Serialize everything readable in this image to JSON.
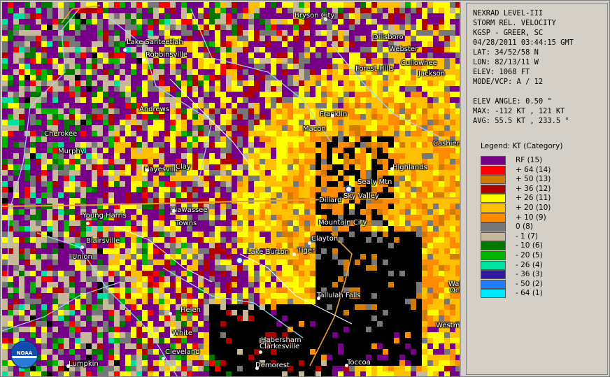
{
  "panel": {
    "product": "NEXRAD LEVEL-III",
    "type": "STORM REL. VELOCITY",
    "site": "KGSP - GREER, SC",
    "datetime": "04/28/2011 03:44:15 GMT",
    "lat": "LAT: 34/52/58 N",
    "lon": "LON: 82/13/11 W",
    "elev": "ELEV: 1068 FT",
    "mode": "MODE/VCP: A / 12",
    "elev_angle": "ELEV ANGLE: 0.50 °",
    "max": "MAX: -112 KT , 121 KT",
    "avg": "AVG: 55.5 KT , 233.5 °"
  },
  "legend": {
    "title": "Legend: KT (Category)",
    "items": [
      {
        "label": "RF  (15)",
        "color": "#770088"
      },
      {
        "label": "+ 64  (14)",
        "color": "#ff0000"
      },
      {
        "label": "+ 50  (13)",
        "color": "#d27b00"
      },
      {
        "label": "+ 36  (12)",
        "color": "#b00000"
      },
      {
        "label": "+ 26  (11)",
        "color": "#ffff00"
      },
      {
        "label": "+ 20  (10)",
        "color": "#ffc000"
      },
      {
        "label": "+ 10  (9)",
        "color": "#ff8c00"
      },
      {
        "label": "0  (8)",
        "color": "#777777"
      },
      {
        "label": "- 1  (7)",
        "color": "#c8b89a"
      },
      {
        "label": "- 10  (6)",
        "color": "#007800"
      },
      {
        "label": "- 20  (5)",
        "color": "#00b400"
      },
      {
        "label": "- 26  (4)",
        "color": "#00e0a0"
      },
      {
        "label": "- 36  (3)",
        "color": "#3018a0"
      },
      {
        "label": "- 50  (2)",
        "color": "#1e7cff"
      },
      {
        "label": "- 64  (1)",
        "color": "#00e8ff"
      }
    ]
  },
  "map": {
    "logo_text": "NOAA",
    "cities": [
      "Bryson City",
      "Dillsboro",
      "Lake Santeetlah",
      "Webster",
      "Robbinsville",
      "Forest Hills",
      "Cullowhee",
      "Jackson",
      "Andrews",
      "Franklin",
      "Macon",
      "Cherokee",
      "Murphy",
      "Cashiers",
      "Hayesville",
      "Clay",
      "Highlands",
      "Sealy Mtn",
      "Sky Valley",
      "Dillard",
      "Hiawassee",
      "Young Harris",
      "Towns",
      "Mountain City",
      "Blairsville",
      "Clayton",
      "Lake Burton",
      "Tiger",
      "Union",
      "Tallulah Falls",
      "Helen",
      "White",
      "Habersham",
      "Clarkesville",
      "Cleveland",
      "Demorest",
      "Toccoa",
      "Westmi",
      "Lumpkin",
      "Wal",
      "Oco"
    ]
  }
}
